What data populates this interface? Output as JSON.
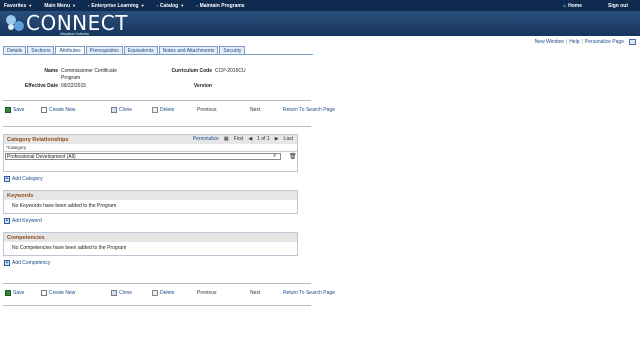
{
  "topnav": {
    "items": [
      "Favorites",
      "Main Menu",
      "Enterprise Learning",
      "Catalog",
      "Maintain Programs"
    ],
    "home": "Home",
    "signout": "Sign out"
  },
  "logo": {
    "title": "CONNECT",
    "subtitle": "Maryland Judiciary"
  },
  "utility": {
    "new_window": "New Window",
    "help": "Help",
    "personalize": "Personalize Page"
  },
  "tabs": [
    "Details",
    "Sections",
    "Attributes",
    "Prerequisites",
    "Equivalents",
    "Notes and Attachments",
    "Security"
  ],
  "active_tab": "Attributes",
  "info": {
    "name_label": "Name",
    "name_value_1": "Commissioner Certificate",
    "name_value_2": "Program",
    "effdate_label": "Effective Date",
    "effdate_value": "09/22/2015",
    "code_label": "Curriculum Code",
    "code_value": "CCP-2015CU",
    "version_label": "Version",
    "version_value": ""
  },
  "toolbar": {
    "save": "Save",
    "create_new": "Create New",
    "clone": "Clone",
    "delete": "Delete",
    "previous": "Previous",
    "next": "Next",
    "return": "Return To Search Page"
  },
  "category": {
    "title": "Category Relationships",
    "personalize": "Personalize",
    "first": "First",
    "range": "1 of 1",
    "last": "Last",
    "column": "*Category",
    "value": "Professional Development (All)",
    "add": "Add Category"
  },
  "keywords": {
    "title": "Keywords",
    "message": "No Keywords have been added to the Program",
    "add": "Add Keyword"
  },
  "competencies": {
    "title": "Competencies",
    "message": "No Competencies have been added to the Program",
    "add": "Add Competency"
  },
  "colors": {
    "nav": "#0e2a4f",
    "header": "#2a4f7c",
    "section_title": "#8a4b1a",
    "link": "#1a4a8a"
  }
}
